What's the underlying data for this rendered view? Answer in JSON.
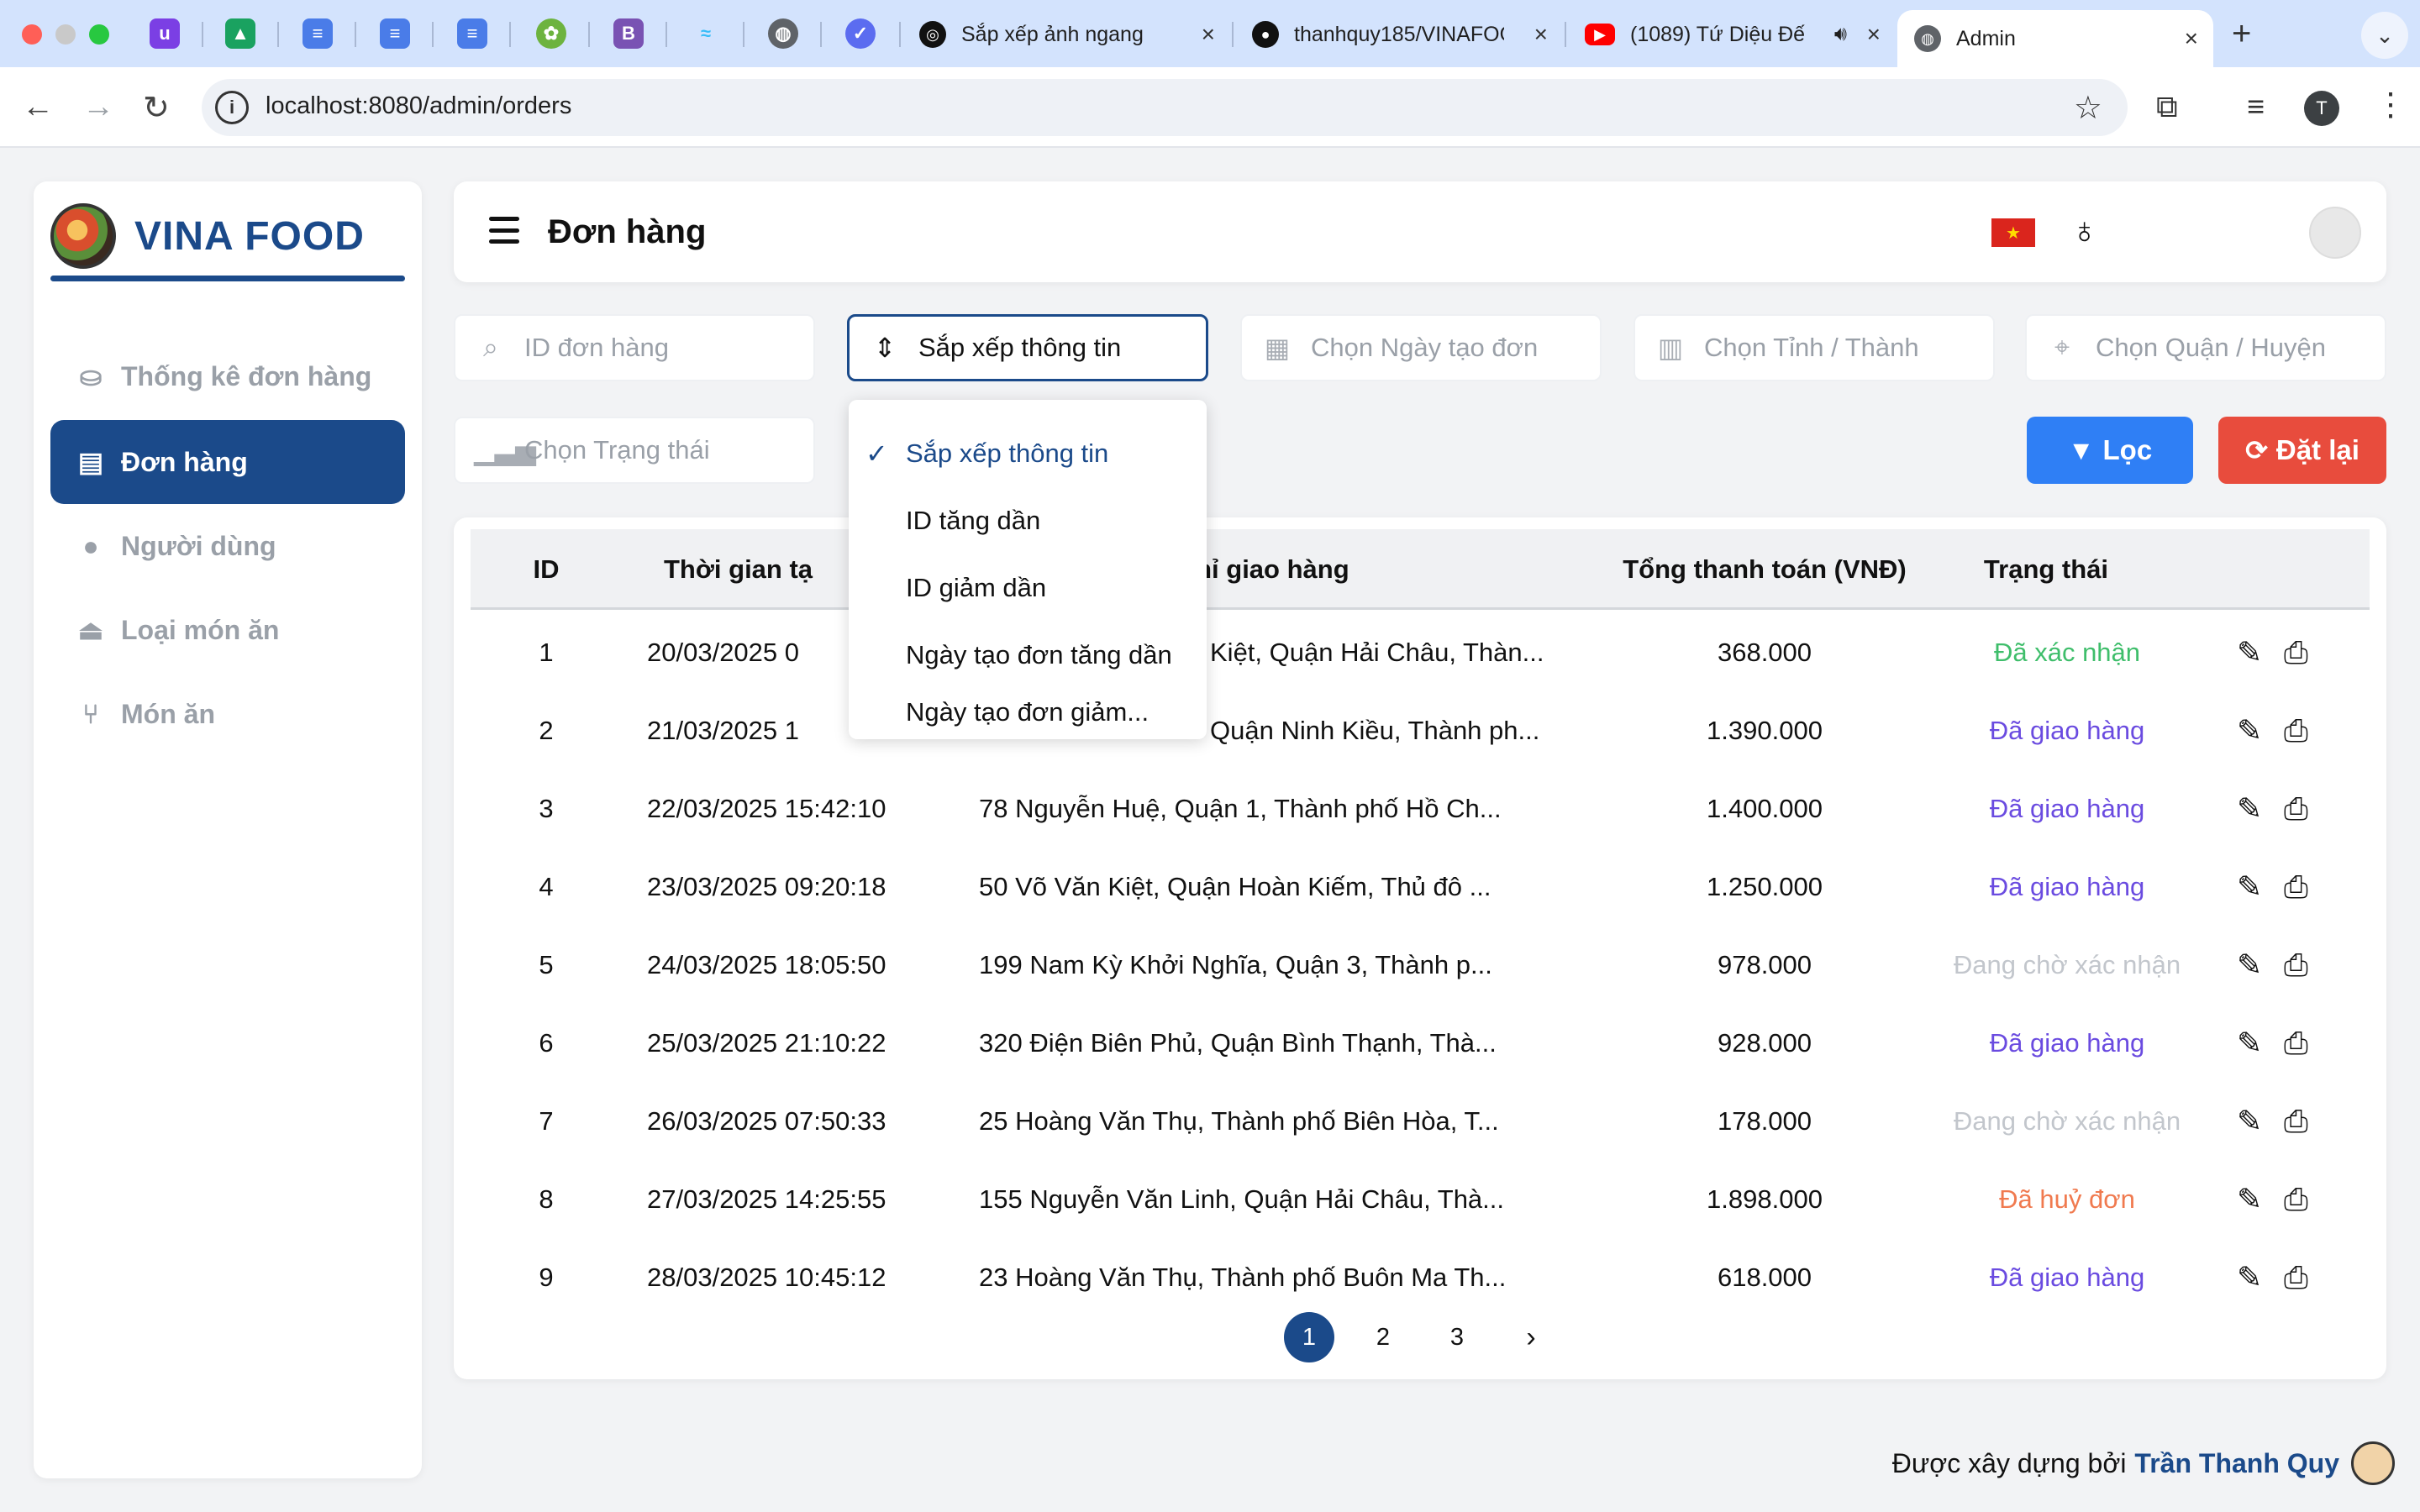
{
  "browser": {
    "tabs": [
      {
        "title": "Sắp xếp ảnh ngang",
        "favicon": "openai-icon"
      },
      {
        "title": "thanhquy185/VINAFOOD",
        "favicon": "github-icon"
      },
      {
        "title": "(1089) Tứ Diệu Đế",
        "favicon": "youtube-icon"
      },
      {
        "title": "Admin",
        "favicon": "globe-icon"
      }
    ],
    "url": "localhost:8080/admin/orders",
    "profile_initial": "T"
  },
  "sidebar": {
    "brand": "VINA FOOD",
    "items": [
      {
        "label": "Thống kê đơn hàng",
        "icon": "hand-money-icon"
      },
      {
        "label": "Đơn hàng",
        "icon": "receipt-icon"
      },
      {
        "label": "Người dùng",
        "icon": "user-icon"
      },
      {
        "label": "Loại món ăn",
        "icon": "cloche-icon"
      },
      {
        "label": "Món ăn",
        "icon": "utensils-icon"
      }
    ]
  },
  "header": {
    "title": "Đơn hàng"
  },
  "filters": {
    "order_id_placeholder": "ID đơn hàng",
    "sort_value": "Sắp xếp thông tin",
    "date_placeholder": "Chọn Ngày tạo đơn",
    "province_placeholder": "Chọn Tỉnh / Thành",
    "district_placeholder": "Chọn Quận / Huyện",
    "status_placeholder": "Chọn Trạng thái",
    "filter_label": "Lọc",
    "reset_label": "Đặt lại"
  },
  "sort_dropdown": {
    "options": [
      "Sắp xếp thông tin",
      "ID tăng dần",
      "ID giảm dần",
      "Ngày tạo đơn tăng dần",
      "Ngày tạo đơn giảm..."
    ],
    "selected_index": 0
  },
  "table": {
    "columns": [
      "ID",
      "Thời gian tạ",
      "a chỉ giao hàng",
      "Tổng thanh toán (VNĐ)",
      "Trạng thái"
    ],
    "rows": [
      {
        "id": "1",
        "time": "20/03/2025 0",
        "address": "Kiệt, Quận Hải Châu, Thàn...",
        "total": "368.000",
        "status": "Đã xác nhận",
        "status_type": "confirmed"
      },
      {
        "id": "2",
        "time": "21/03/2025 1",
        "address": "Quận Ninh Kiều, Thành ph...",
        "total": "1.390.000",
        "status": "Đã giao hàng",
        "status_type": "delivered"
      },
      {
        "id": "3",
        "time": "22/03/2025 15:42:10",
        "address": "78 Nguyễn Huệ, Quận 1, Thành phố Hồ Ch...",
        "total": "1.400.000",
        "status": "Đã giao hàng",
        "status_type": "delivered"
      },
      {
        "id": "4",
        "time": "23/03/2025 09:20:18",
        "address": "50 Võ Văn Kiệt, Quận Hoàn Kiếm, Thủ đô ...",
        "total": "1.250.000",
        "status": "Đã giao hàng",
        "status_type": "delivered"
      },
      {
        "id": "5",
        "time": "24/03/2025 18:05:50",
        "address": "199 Nam Kỳ Khởi Nghĩa, Quận 3, Thành p...",
        "total": "978.000",
        "status": "Đang chờ xác nhận",
        "status_type": "pending"
      },
      {
        "id": "6",
        "time": "25/03/2025 21:10:22",
        "address": "320 Điện Biên Phủ, Quận Bình Thạnh, Thà...",
        "total": "928.000",
        "status": "Đã giao hàng",
        "status_type": "delivered"
      },
      {
        "id": "7",
        "time": "26/03/2025 07:50:33",
        "address": "25 Hoàng Văn Thụ, Thành phố Biên Hòa, T...",
        "total": "178.000",
        "status": "Đang chờ xác nhận",
        "status_type": "pending"
      },
      {
        "id": "8",
        "time": "27/03/2025 14:25:55",
        "address": "155 Nguyễn Văn Linh, Quận Hải Châu, Thà...",
        "total": "1.898.000",
        "status": "Đã huỷ đơn",
        "status_type": "cancelled"
      },
      {
        "id": "9",
        "time": "28/03/2025 10:45:12",
        "address": "23 Hoàng Văn Thụ, Thành phố Buôn Ma Th...",
        "total": "618.000",
        "status": "Đã giao hàng",
        "status_type": "delivered"
      }
    ]
  },
  "pagination": {
    "pages": [
      "1",
      "2",
      "3"
    ],
    "current": "1"
  },
  "footer": {
    "prefix": "Được xây dựng bởi",
    "author": "Trần Thanh Quy"
  },
  "colors": {
    "brand": "#1b4a8a",
    "filter_button": "#2f7ff5",
    "reset_button": "#e84c3d",
    "status_confirmed": "#3fbe6b",
    "status_delivered": "#6a4be0",
    "status_pending": "#c2c6cc",
    "status_cancelled": "#f07a4f"
  }
}
